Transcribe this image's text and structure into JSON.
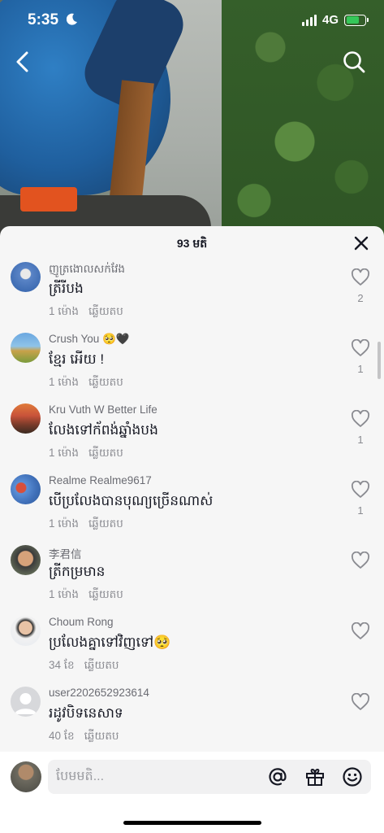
{
  "status_bar": {
    "time": "5:35",
    "network": "4G",
    "icons": [
      "moon-icon",
      "signal-icon",
      "battery-icon"
    ]
  },
  "video": {
    "icons": [
      "back-arrow-icon",
      "search-icon"
    ]
  },
  "sheet": {
    "title": "93 មតិ",
    "close_icon": "close-icon"
  },
  "colors": {
    "sheet_bg": "#f6f6f6",
    "text": "#161823",
    "muted": "#8a8b91"
  },
  "comments": [
    {
      "user": "ញូត្រងោលសក់វែង",
      "text": "ត្រីរីបង",
      "time": "1 ម៉ោង",
      "reply": "ឆ្លើយតប",
      "likes": "2"
    },
    {
      "user": "Crush You 🥺🖤",
      "text": "ខ្មែរ អើយ !",
      "time": "1 ម៉ោង",
      "reply": "ឆ្លើយតប",
      "likes": "1"
    },
    {
      "user": "Kru Vuth W Better Life",
      "text": "លែងទៅក័ពង់ឆ្នាំងបង",
      "time": "1 ម៉ោង",
      "reply": "ឆ្លើយតប",
      "likes": "1"
    },
    {
      "user": "Realme Realme9617",
      "text": "បើប្រលែងបានបុណ្យច្រើនណាស់",
      "time": "1 ម៉ោង",
      "reply": "ឆ្លើយតប",
      "likes": "1"
    },
    {
      "user": "李君信",
      "text": "ត្រីកម្រមាន",
      "time": "1 ម៉ោង",
      "reply": "ឆ្លើយតប",
      "likes": ""
    },
    {
      "user": "Choum Rong",
      "text": "ប្រលែងគ្នាទៅវិញទៅ🥺",
      "time": "34 ខែ",
      "reply": "ឆ្លើយតប",
      "likes": ""
    },
    {
      "user": "user2202652923614",
      "text": "រដូវបិទនេសាទ",
      "time": "40 ខែ",
      "reply": "ឆ្លើយតប",
      "likes": ""
    }
  ],
  "input": {
    "placeholder": "បែមមតិ...",
    "icons": [
      "mention-icon",
      "gift-icon",
      "emoji-icon"
    ]
  }
}
